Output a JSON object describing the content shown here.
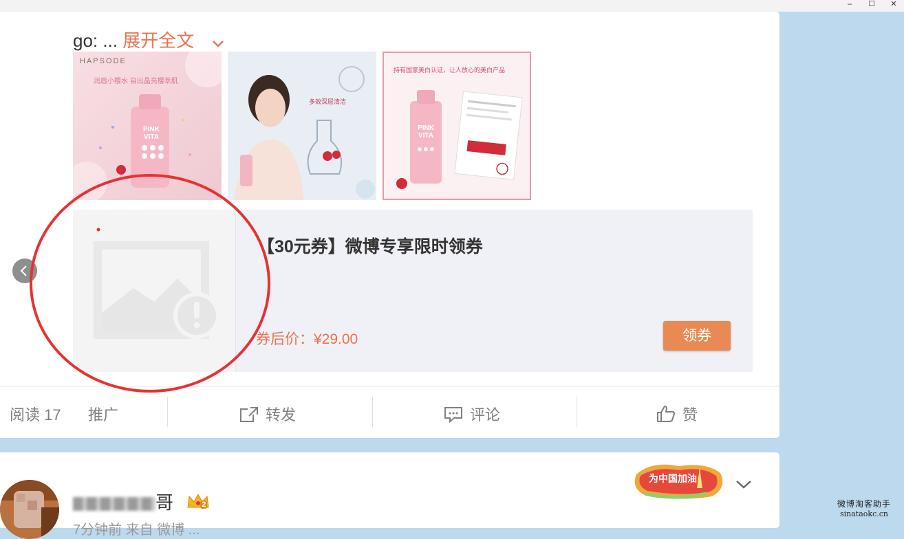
{
  "window": {
    "controls": [
      "–",
      "☐",
      "✕"
    ]
  },
  "post": {
    "text_prefix": "go: ...",
    "expand_label": "展开全文",
    "images": [
      {
        "brand": "HAPSODE",
        "caption": "润唇小樱水 自出晶亮樱萃肌",
        "product": "PINK VITA"
      },
      {
        "caption": "多效深层清洁"
      },
      {
        "caption": "持有国家美白认证，让人放心的美白产品",
        "product": "PINK VITA"
      }
    ],
    "coupon": {
      "title": "【30元券】微博专享限时领券",
      "price": "券后价：¥29.00",
      "button": "领券"
    },
    "actions": {
      "read": "阅读 17",
      "promo": "推广",
      "repost": "转发",
      "comment": "评论",
      "like": "赞"
    }
  },
  "next_post": {
    "name_suffix": "哥",
    "badge_text": "为中国加油",
    "level": "2",
    "subline": "7分钟前 来自 微博 ..."
  },
  "watermark": {
    "line1": "微博淘客助手",
    "line2": "sinataokc.cn"
  },
  "colors": {
    "accent": "#eb7350",
    "button": "#e98a55",
    "annotation": "#e53333",
    "page_bg": "#bcd9ee"
  }
}
